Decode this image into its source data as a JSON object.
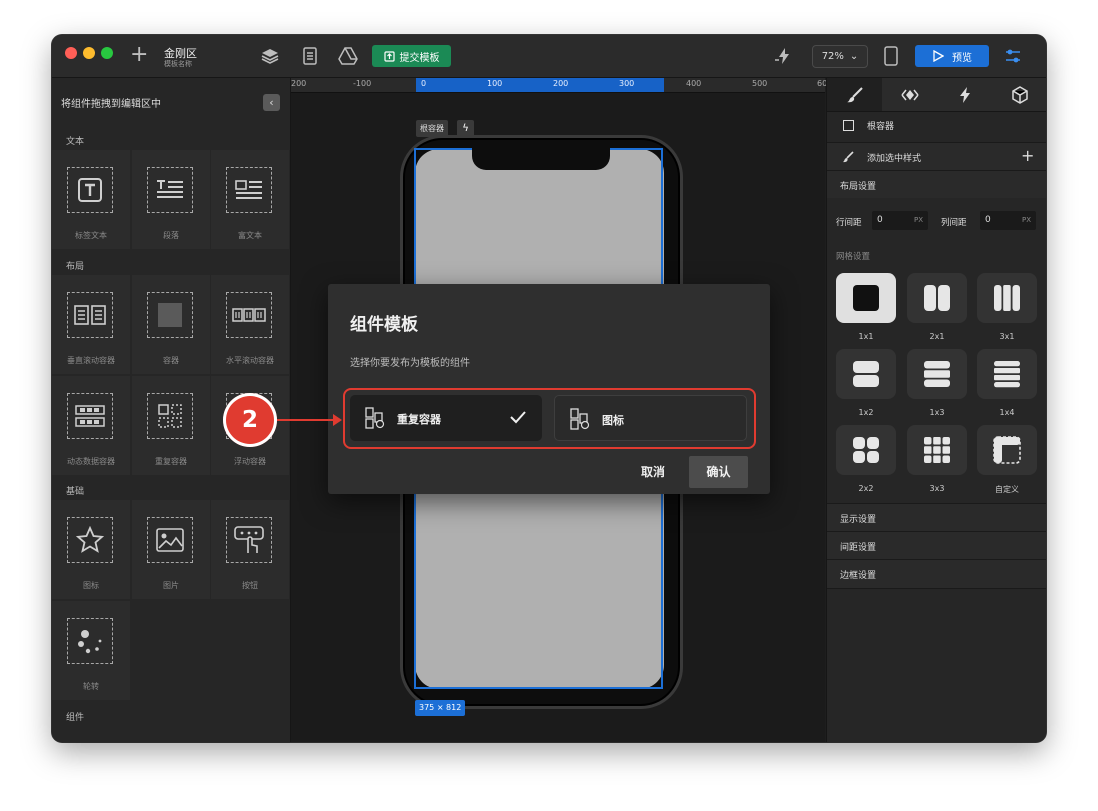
{
  "window": {
    "traffic_lights": [
      "#ff5f57",
      "#febc2e",
      "#28c840"
    ],
    "project_name": "金刚区",
    "project_sub": "模板名称",
    "submit_template": "提交模板",
    "zoom": "72%",
    "preview": "预览"
  },
  "left_panel": {
    "header": "将组件拖拽到编辑区中",
    "sections": [
      {
        "title": "文本",
        "items": [
          "标签文本",
          "段落",
          "富文本"
        ]
      },
      {
        "title": "布局",
        "items": [
          "垂直滚动容器",
          "容器",
          "水平滚动容器",
          "动态数据容器",
          "重复容器",
          "浮动容器"
        ]
      },
      {
        "title": "基础",
        "items": [
          "图标",
          "图片",
          "按钮",
          "轮转"
        ]
      },
      {
        "title": "组件",
        "items": []
      }
    ]
  },
  "canvas": {
    "ruler": [
      "200",
      "-100",
      "0",
      "100",
      "200",
      "300",
      "400",
      "500",
      "60"
    ],
    "root_tag": "根容器",
    "size_tag": "375 × 812"
  },
  "right_panel": {
    "root_container": "根容器",
    "add_selected_style": "添加选中样式",
    "layout_settings": "布局设置",
    "row_gap_label": "行间距",
    "row_gap_value": "0",
    "col_gap_label": "列间距",
    "col_gap_value": "0",
    "unit": "PX",
    "grid_settings": "网格设置",
    "grid_options": [
      "1x1",
      "2x1",
      "3x1",
      "1x2",
      "1x3",
      "1x4",
      "2x2",
      "3x3",
      "自定义"
    ],
    "display_settings": "显示设置",
    "spacing_settings": "间距设置",
    "border_settings": "边框设置"
  },
  "modal": {
    "title": "组件模板",
    "subtitle": "选择你要发布为模板的组件",
    "option_a": "重复容器",
    "option_b": "图标",
    "cancel": "取消",
    "confirm": "确认"
  },
  "annotation": {
    "step": "2",
    "color": "#e03b30"
  },
  "colors": {
    "accent": "#1c6fd6",
    "submit": "#1b8a55"
  }
}
